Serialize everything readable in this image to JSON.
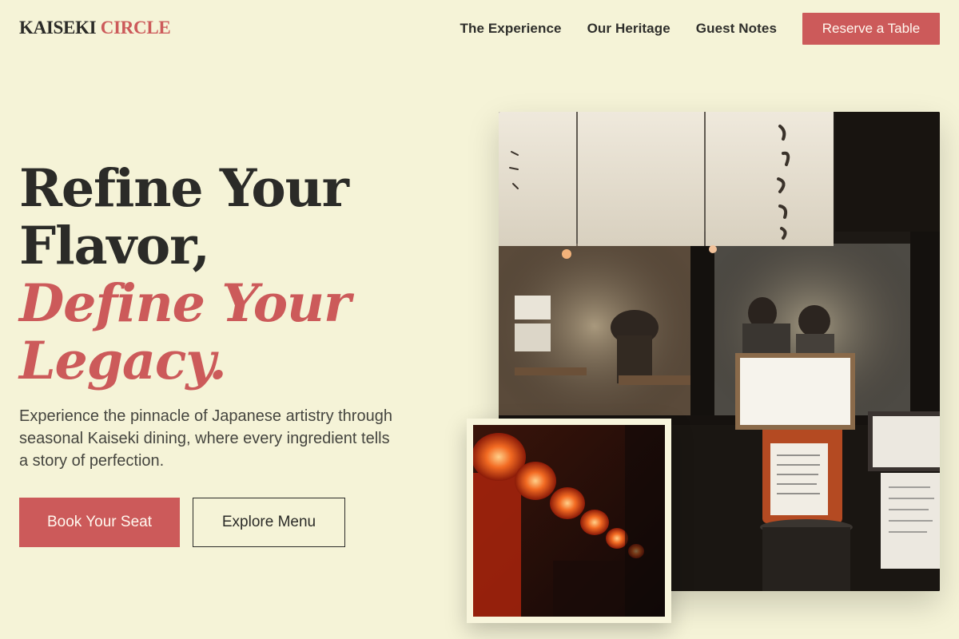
{
  "brand": {
    "name_primary": "KAISEKI",
    "name_accent": "CIRCLE"
  },
  "nav": {
    "links": [
      "The Experience",
      "Our Heritage",
      "Guest Notes"
    ],
    "cta": "Reserve a Table"
  },
  "hero": {
    "headline_lines": [
      "Refine Your",
      "Flavor,"
    ],
    "headline_accent_lines": [
      "Define Your",
      "Legacy."
    ],
    "lead": "Experience the pinnacle of Japanese artistry through seasonal Kaiseki dining, where every ingredient tells a story of perfection.",
    "primary_button": "Book Your Seat",
    "secondary_button": "Explore Menu"
  },
  "colors": {
    "background": "#f5f3d7",
    "accent": "#cc5a5a",
    "text": "#2b2b28"
  }
}
